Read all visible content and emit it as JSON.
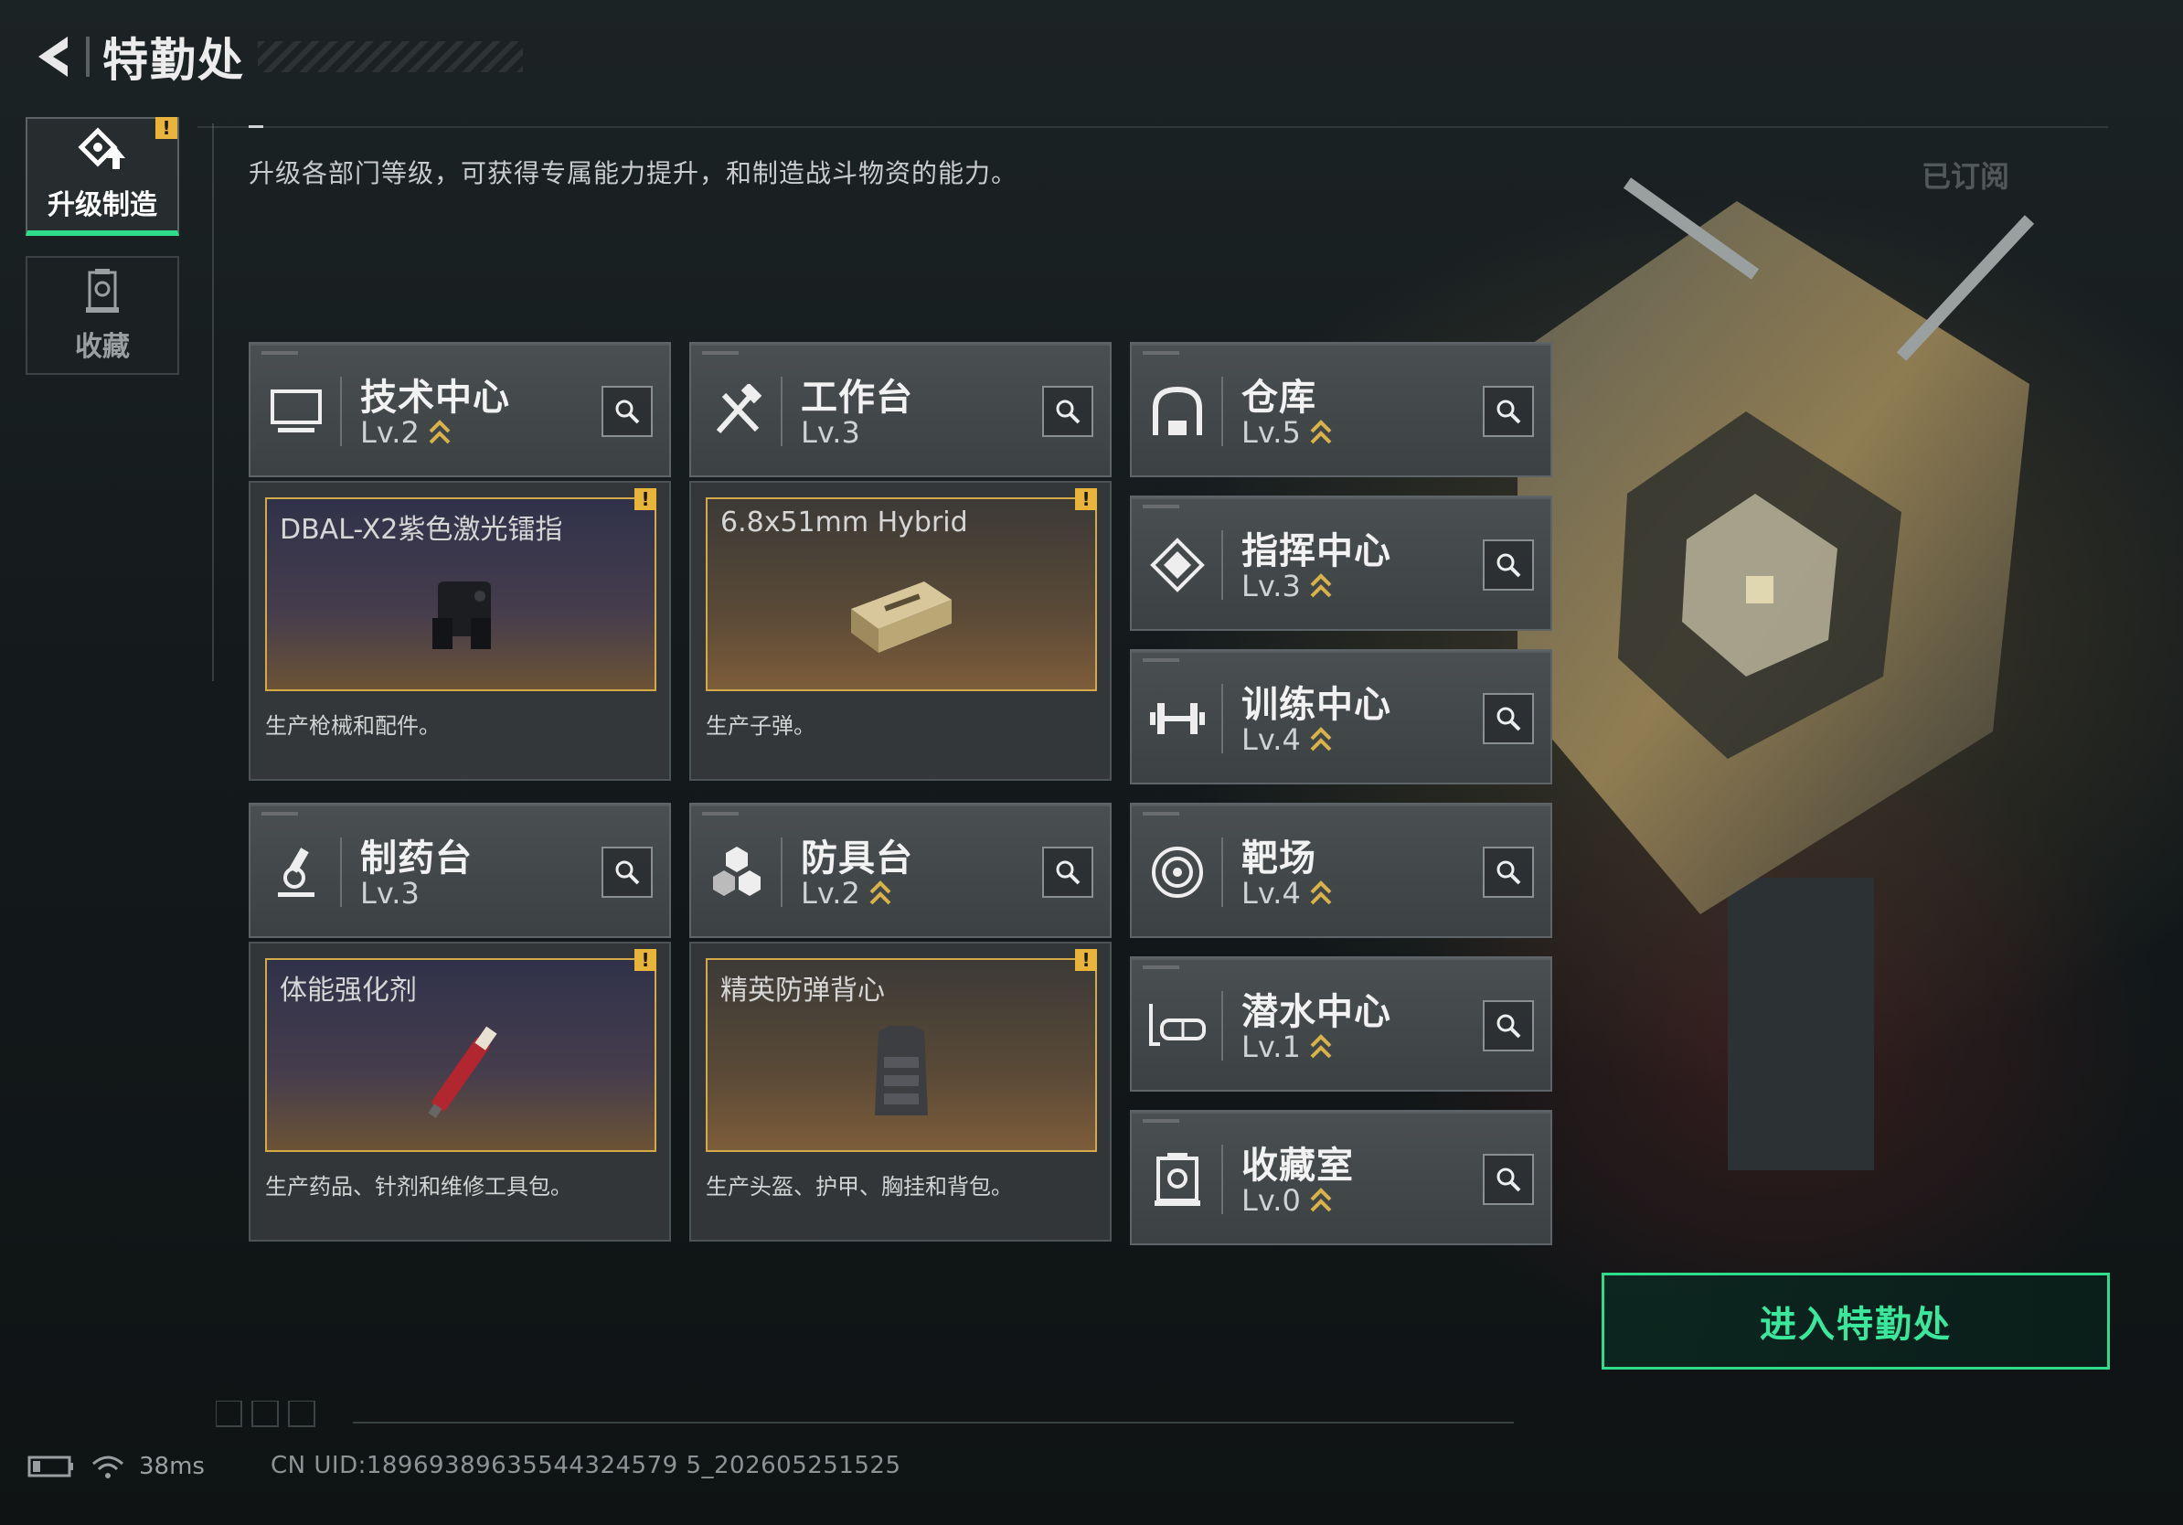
{
  "header": {
    "title": "特勤处"
  },
  "sidebar": {
    "tabs": [
      {
        "label": "升级制造",
        "selected": true,
        "has_alert": true,
        "alert_mark": "!"
      },
      {
        "label": "收藏",
        "selected": false,
        "has_alert": false
      }
    ]
  },
  "main": {
    "subtitle": "升级各部门等级，可获得专属能力提升，和制造战斗物资的能力。",
    "subscribed_label": "已订阅"
  },
  "departments": [
    {
      "name": "技术中心",
      "level": "Lv.2",
      "upgradeable": true,
      "icon": "monitor-icon",
      "production": {
        "item": "DBAL-X2紫色激光镭指",
        "desc": "生产枪械和配件。",
        "alert": "!",
        "style": "purple"
      }
    },
    {
      "name": "工作台",
      "level": "Lv.3",
      "upgradeable": false,
      "icon": "tools-icon",
      "production": {
        "item": "6.8x51mm Hybrid",
        "desc": "生产子弹。",
        "alert": "!",
        "style": "brown"
      }
    },
    {
      "name": "制药台",
      "level": "Lv.3",
      "upgradeable": false,
      "icon": "microscope-icon",
      "production": {
        "item": "体能强化剂",
        "desc": "生产药品、针剂和维修工具包。",
        "alert": "!",
        "style": "purple"
      }
    },
    {
      "name": "防具台",
      "level": "Lv.2",
      "upgradeable": true,
      "icon": "armor-hex-icon",
      "production": {
        "item": "精英防弹背心",
        "desc": "生产头盔、护甲、胸挂和背包。",
        "alert": "!",
        "style": "brown"
      }
    },
    {
      "name": "仓库",
      "level": "Lv.5",
      "upgradeable": true,
      "icon": "warehouse-icon"
    },
    {
      "name": "指挥中心",
      "level": "Lv.3",
      "upgradeable": true,
      "icon": "command-icon"
    },
    {
      "name": "训练中心",
      "level": "Lv.4",
      "upgradeable": true,
      "icon": "dumbbell-icon"
    },
    {
      "name": "靶场",
      "level": "Lv.4",
      "upgradeable": true,
      "icon": "target-icon"
    },
    {
      "name": "潜水中心",
      "level": "Lv.1",
      "upgradeable": true,
      "icon": "diving-mask-icon"
    },
    {
      "name": "收藏室",
      "level": "Lv.0",
      "upgradeable": true,
      "icon": "collection-icon"
    }
  ],
  "actions": {
    "enter_label": "进入特勤处"
  },
  "status": {
    "ping": "38ms",
    "uid": "CN UID:18969389635544324579 5_202605251525"
  },
  "colors": {
    "accent_green": "#2fdc8c",
    "alert_yellow": "#e8b53a",
    "item_border_gold": "#d4a94a",
    "level_arrow": "#d9b34a"
  }
}
